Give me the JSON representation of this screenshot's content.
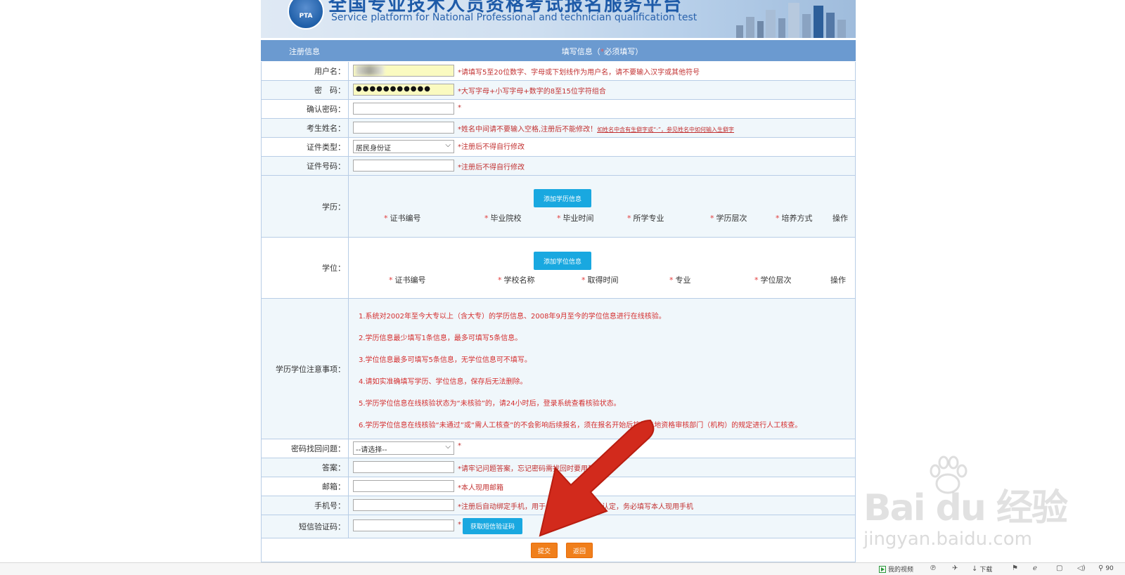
{
  "banner": {
    "title_cn": "全国专业技术人员资格考试报名服务平台",
    "title_en": "Service platform for National Professional and technician  qualification test",
    "logo_text": "PTA"
  },
  "header": {
    "left": "注册信息",
    "right_prefix": "填写信息（",
    "right_star": "*",
    "right_suffix": "必须填写）"
  },
  "form": {
    "username": {
      "label": "用户名：",
      "hint": "*请填写5至20位数字、字母或下划线作为用户名，请不要输入汉字或其他符号"
    },
    "password": {
      "label": "密　码：",
      "value": "●●●●●●●●●●●",
      "hint": "*大写字母+小写字母+数字的8至15位字符组合"
    },
    "confirm": {
      "label": "确认密码：",
      "hint": "*"
    },
    "name": {
      "label": "考生姓名：",
      "hint": "*姓名中间请不要输入空格,注册后不能修改！",
      "link": "如姓名中含有生僻字或“·”，参见姓名中如何输入生僻字"
    },
    "id_type": {
      "label": "证件类型：",
      "value": "居民身份证",
      "hint": "*注册后不得自行修改"
    },
    "id_number": {
      "label": "证件号码：",
      "hint": "*注册后不得自行修改"
    },
    "education": {
      "label": "学历：",
      "add_button": "添加学历信息",
      "columns": [
        "证书编号",
        "毕业院校",
        "毕业时间",
        "所学专业",
        "学历层次",
        "培养方式"
      ],
      "action": "操作"
    },
    "degree": {
      "label": "学位：",
      "add_button": "添加学位信息",
      "columns": [
        "证书编号",
        "学校名称",
        "取得时间",
        "专业",
        "学位层次"
      ],
      "action": "操作"
    },
    "notes": {
      "label": "学历学位注意事项：",
      "items": [
        "1.系统对2002年至今大专以上（含大专）的学历信息、2008年9月至今的学位信息进行在线核验。",
        "2.学历信息最少填写1条信息，最多可填写5条信息。",
        "3.学位信息最多可填写5条信息，无学位信息可不填写。",
        "4.请如实准确填写学历、学位信息，保存后无法删除。",
        "5.学历学位信息在线核验状态为“未核验”的，请24小时后，登录系统查看核验状态。",
        "6.学历学位信息在线核验“未通过”或“需人工核查”的不会影响后续报名，须在报名开始后按报名地资格审核部门（机构）的规定进行人工核查。"
      ]
    },
    "question": {
      "label": "密码找回问题：",
      "value": "--请选择--",
      "hint": "*"
    },
    "answer": {
      "label": "答案：",
      "hint": "*请牢记问题答案，忘记密码需找回时要用到"
    },
    "email": {
      "label": "邮箱：",
      "hint": "*本人现用邮箱"
    },
    "phone": {
      "label": "手机号：",
      "hint": "*注册后自动绑定手机，用于一些重要操作身份认定，务必填写本人现用手机"
    },
    "sms": {
      "label": "短信验证码：",
      "hint": "*",
      "button": "获取短信验证码"
    }
  },
  "actions": {
    "submit": "提交",
    "back": "返回"
  },
  "watermark": {
    "brand": "Bai du 经验",
    "url": "jingyan.baidu.com"
  },
  "taskbar": {
    "items": [
      "我的视频",
      "下载",
      "90"
    ]
  },
  "colors": {
    "header_blue": "#6b9ad0",
    "button_blue": "#19a8e0",
    "button_orange": "#f07f1c",
    "hint_red": "#c23131",
    "arrow_red": "#d22a1c"
  }
}
